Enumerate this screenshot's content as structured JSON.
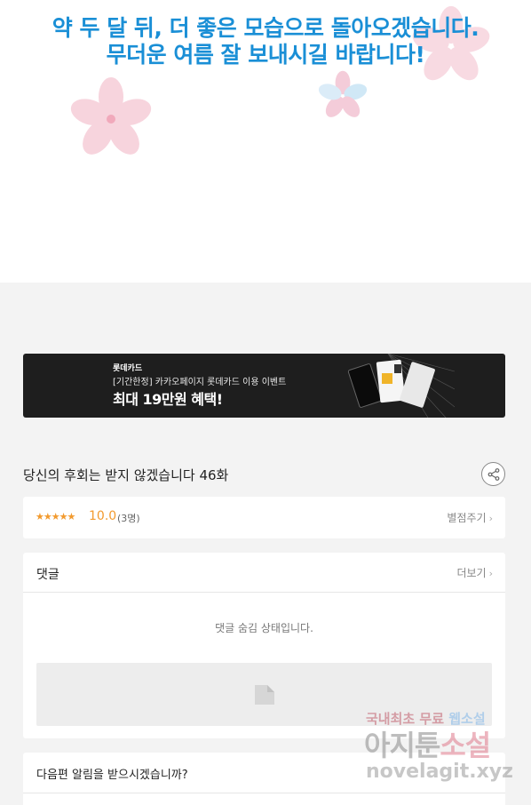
{
  "notice": {
    "line1": "약 두 달 뒤, 더 좋은 모습으로 돌아오겠습니다.",
    "line2": "무더운 여름 잘 보내시길 바랍니다!"
  },
  "banner": {
    "brand": "롯데카드",
    "subtitle": "[기간한정] 카카오페이지 롯데카드 이용 이벤트",
    "title": "최대 19만원 혜택!"
  },
  "episode": {
    "title": "당신의 후회는 받지 않겠습니다 46화",
    "share_icon": "share-icon"
  },
  "rating": {
    "stars": "★★★★★",
    "score": "10.0",
    "count": "(3명)",
    "rate_label": "별점주기",
    "chevron": "›"
  },
  "comments": {
    "label": "댓글",
    "more_label": "더보기",
    "chevron": "›",
    "hidden_message": "댓글 숨김 상태입니다."
  },
  "notify": {
    "question": "다음편 알림을 받으시겠습니까?"
  },
  "watermark": {
    "top_prefix": "국내최초 무료 ",
    "top_highlight": "웹소설",
    "main_gray": "아지툰",
    "main_pink": "소설",
    "url": "novelagit.xyz"
  },
  "colors": {
    "notice_text": "#1a8fd6",
    "rating_accent": "#f29a2e",
    "banner_bg": "#1e1e1e",
    "page_bg": "#f3f3f3"
  }
}
